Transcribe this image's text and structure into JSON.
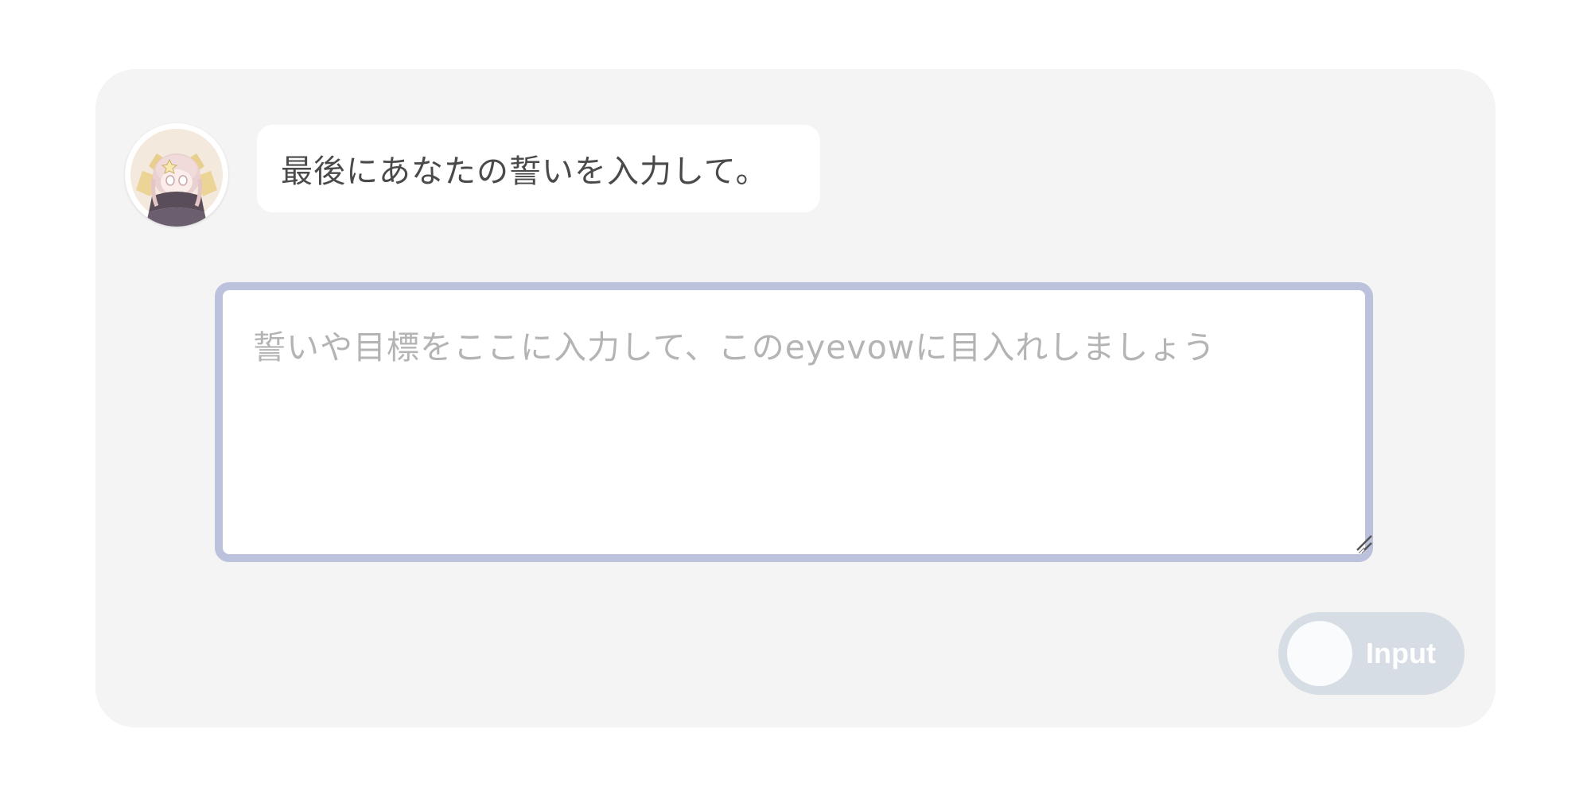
{
  "chat": {
    "avatar_icon": "character-avatar-icon",
    "message": "最後にあなたの誓いを入力して。"
  },
  "vow_input": {
    "value": "",
    "placeholder": "誓いや目標をここに入力して、このeyevowに目入れしましょう",
    "border_color": "#bcc1dc"
  },
  "toggle": {
    "label": "Input",
    "state": "off",
    "track_color": "#d7dde5"
  },
  "colors": {
    "card_background": "#f4f4f4",
    "page_background": "#ffffff"
  }
}
